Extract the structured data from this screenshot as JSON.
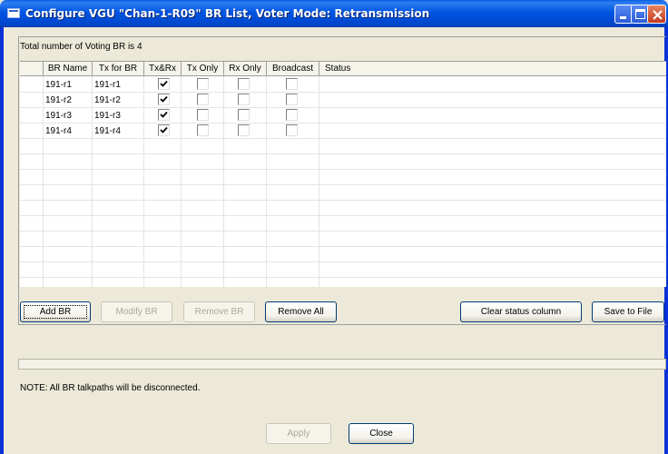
{
  "window": {
    "title": "Configure VGU \"Chan-1-R09\" BR List, Voter Mode: Retransmission"
  },
  "summary": {
    "total_text": "Total number of Voting BR is 4"
  },
  "table": {
    "columns": [
      "",
      "BR Name",
      "Tx for BR",
      "Tx&Rx",
      "Tx Only",
      "Rx Only",
      "Broadcast",
      "Status"
    ],
    "rows": [
      {
        "br_name": "191-r1",
        "tx_for_br": "191-r1",
        "txrx": true,
        "tx_only": false,
        "rx_only": false,
        "broadcast": false,
        "status": ""
      },
      {
        "br_name": "191-r2",
        "tx_for_br": "191-r2",
        "txrx": true,
        "tx_only": false,
        "rx_only": false,
        "broadcast": false,
        "status": ""
      },
      {
        "br_name": "191-r3",
        "tx_for_br": "191-r3",
        "txrx": true,
        "tx_only": false,
        "rx_only": false,
        "broadcast": false,
        "status": ""
      },
      {
        "br_name": "191-r4",
        "tx_for_br": "191-r4",
        "txrx": true,
        "tx_only": false,
        "rx_only": false,
        "broadcast": false,
        "status": ""
      }
    ]
  },
  "buttons": {
    "add_br": "Add BR",
    "modify_br": "Modify BR",
    "remove_br": "Remove BR",
    "remove_all": "Remove All",
    "clear_status": "Clear status column",
    "save_to_file": "Save to File",
    "apply": "Apply",
    "close": "Close"
  },
  "note": "NOTE: All BR talkpaths will be disconnected."
}
